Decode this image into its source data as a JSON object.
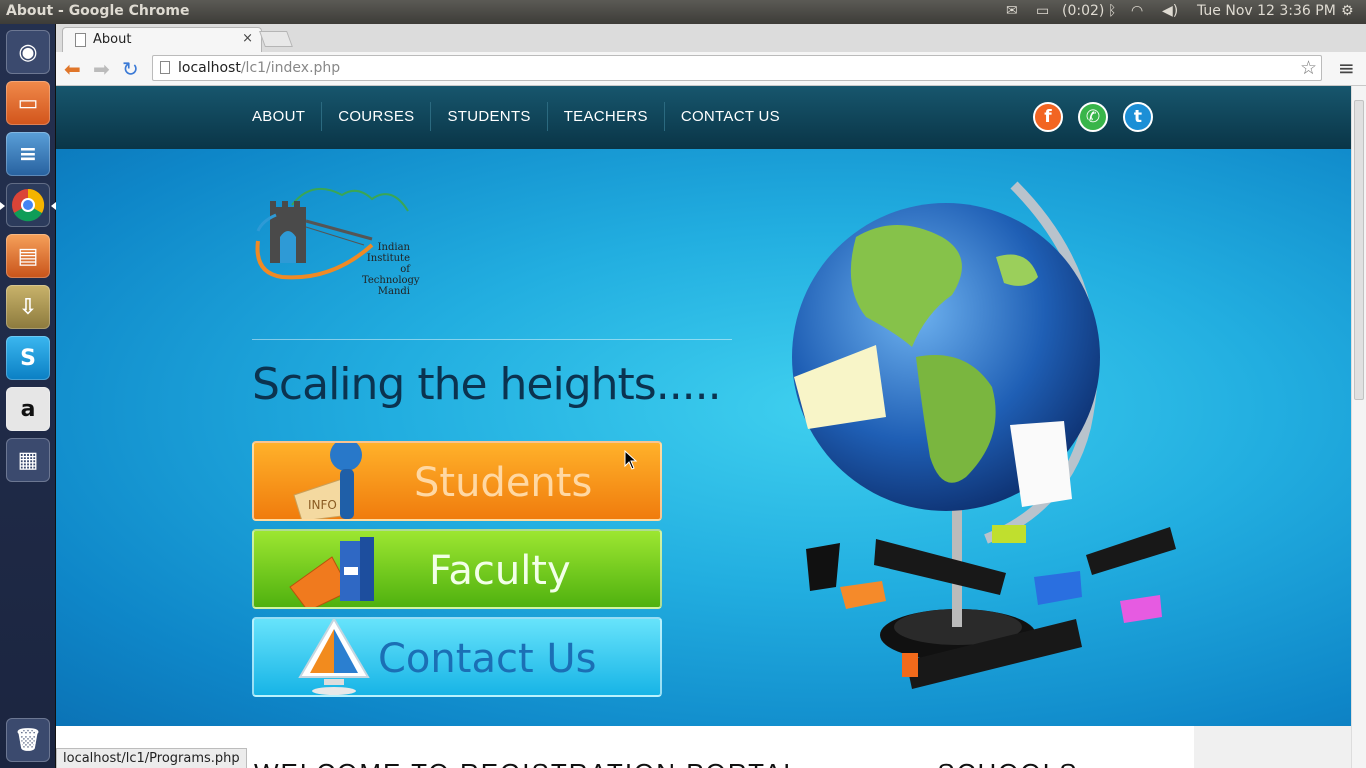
{
  "system_panel": {
    "window_title": "About - Google Chrome",
    "battery": "(0:02)",
    "datetime": "Tue Nov 12  3:36 PM"
  },
  "launcher": {
    "items": [
      "dash-home",
      "files",
      "libreoffice-writer",
      "chrome",
      "libreoffice-impress",
      "archive-manager",
      "skype",
      "amazon",
      "workspace-switcher",
      "trash"
    ]
  },
  "browser": {
    "tab_title": "About",
    "tab_close": "×",
    "url_host": "localhost",
    "url_path": "/lc1/index.php",
    "status_url": "localhost/lc1/Programs.php"
  },
  "site": {
    "nav": [
      "ABOUT",
      "COURSES",
      "STUDENTS",
      "TEACHERS",
      "CONTACT US"
    ],
    "logo_text": "Indian Institute of Technology Mandi",
    "tagline": "Scaling the heights.....",
    "buttons": {
      "students": "Students",
      "faculty": "Faculty",
      "contact": "Contact Us"
    },
    "welcome": "WELCOME TO REGISTRATION PORTAL",
    "welcome_right": "SCHOOLS"
  },
  "colors": {
    "navbar": "#0a3547",
    "hero": "#22aee0",
    "students_btn": "#f07c0d",
    "faculty_btn": "#4fb10f",
    "contact_btn": "#17b4e6",
    "social_1": "#f26522",
    "social_2": "#39b54a",
    "social_3": "#1c8fd6"
  }
}
